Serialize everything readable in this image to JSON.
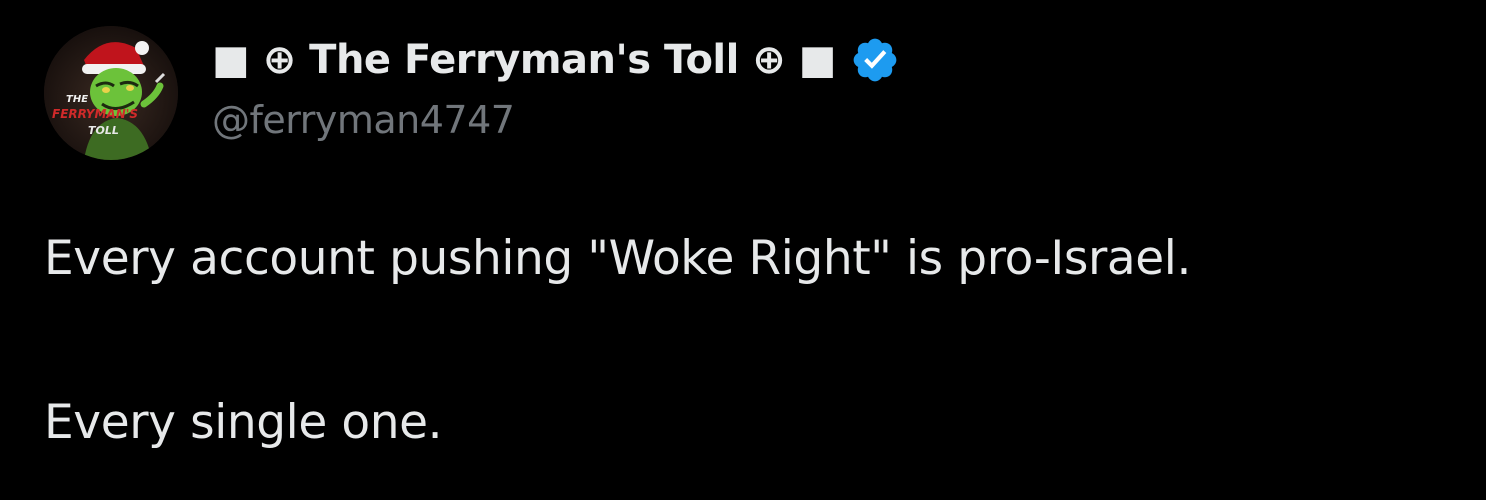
{
  "tweet": {
    "author": {
      "display_name": "■ ⊕ The Ferryman's Toll ⊕ ■",
      "handle": "@ferryman4747",
      "verified": true,
      "verified_color": "#1d9bf0",
      "avatar": {
        "icon": "grinch-santa-avatar",
        "text_lines": [
          "THE",
          "FERRYMAN'S",
          "TOLL"
        ]
      }
    },
    "paragraphs": [
      "Every account pushing \"Woke Right\" is pro-Israel.",
      "Every single one."
    ]
  },
  "colors": {
    "background": "#000000",
    "text_primary": "#e7e9ea",
    "text_secondary": "#71767b",
    "verified_badge": "#1d9bf0"
  }
}
